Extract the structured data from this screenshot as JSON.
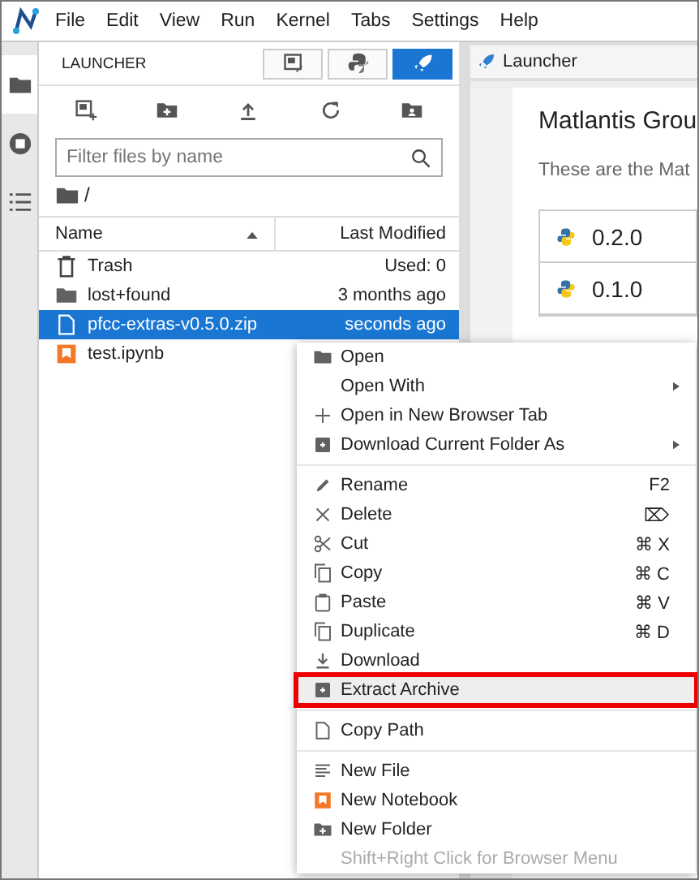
{
  "menubar": [
    "File",
    "Edit",
    "View",
    "Run",
    "Kernel",
    "Tabs",
    "Settings",
    "Help"
  ],
  "sidebar_tabs": [
    {
      "kind": "folder",
      "selected": true
    },
    {
      "kind": "running",
      "selected": false
    },
    {
      "kind": "toc",
      "selected": false
    }
  ],
  "file_browser": {
    "title": "LAUNCHER",
    "search": {
      "placeholder": "Filter files by name"
    },
    "path": "/",
    "columns": [
      {
        "label": "Name"
      },
      {
        "label": "Last Modified"
      }
    ],
    "rows": [
      {
        "kind": "trash",
        "name": "Trash",
        "modified": "Used: 0",
        "selected": false
      },
      {
        "kind": "folder",
        "name": "lost+found",
        "modified": "3 months ago",
        "selected": false
      },
      {
        "kind": "file",
        "name": "pfcc-extras-v0.5.0.zip",
        "modified": "seconds ago",
        "selected": true
      },
      {
        "kind": "notebook",
        "name": "test.ipynb",
        "modified": "",
        "selected": false
      }
    ]
  },
  "main": {
    "tab": "Launcher",
    "heading": "Matlantis Grou",
    "description": "These are the Mat",
    "cards": [
      "0.2.0",
      "0.1.0"
    ]
  },
  "context_menu": [
    {
      "kind": "item",
      "label": "Open",
      "selected": false
    },
    {
      "kind": "item",
      "label": "Open With",
      "submenu": true,
      "selected": false
    },
    {
      "kind": "item",
      "label": "Open in New Browser Tab",
      "selected": false
    },
    {
      "kind": "item",
      "label": "Download Current Folder As",
      "submenu": true,
      "selected": false
    },
    {
      "kind": "separator"
    },
    {
      "kind": "item",
      "label": "Rename",
      "shortcut": "F2",
      "selected": false
    },
    {
      "kind": "item",
      "label": "Delete",
      "shortcut": "⌦",
      "selected": false
    },
    {
      "kind": "item",
      "label": "Cut",
      "shortcut": "⌘ X",
      "selected": false
    },
    {
      "kind": "item",
      "label": "Copy",
      "shortcut": "⌘ C",
      "selected": false
    },
    {
      "kind": "item",
      "label": "Paste",
      "shortcut": "⌘ V",
      "selected": false
    },
    {
      "kind": "item",
      "label": "Duplicate",
      "shortcut": "⌘ D",
      "selected": false
    },
    {
      "kind": "item",
      "label": "Download",
      "selected": false
    },
    {
      "kind": "item",
      "label": "Extract Archive",
      "selected": true,
      "annotated": true
    },
    {
      "kind": "separator"
    },
    {
      "kind": "item",
      "label": "Copy Path",
      "selected": false
    },
    {
      "kind": "separator"
    },
    {
      "kind": "item",
      "label": "New File",
      "selected": false
    },
    {
      "kind": "item",
      "label": "New Notebook",
      "selected": false
    },
    {
      "kind": "item",
      "label": "New Folder",
      "selected": false
    },
    {
      "kind": "hint",
      "label": "Shift+Right Click for Browser Menu"
    }
  ]
}
